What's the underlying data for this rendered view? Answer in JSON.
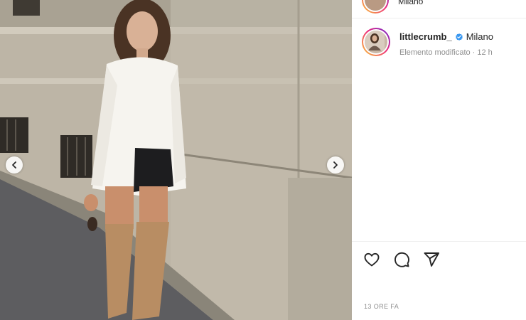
{
  "post": {
    "username": "littlecrumb_",
    "location": "Milano",
    "subtitle": "Elemento modificato",
    "age": "12 h",
    "timestamp": "13 ORE FA"
  },
  "previous_post": {
    "location": "Milano"
  },
  "icons": {
    "verified": "verified-badge-icon",
    "like": "heart-icon",
    "comment": "comment-bubble-icon",
    "share": "paper-plane-icon",
    "prev": "chevron-left-icon",
    "next": "chevron-right-icon"
  },
  "colors": {
    "verified_blue": "#3897f0",
    "muted_text": "#8e8e8e",
    "text": "#262626",
    "divider": "#efefef"
  }
}
